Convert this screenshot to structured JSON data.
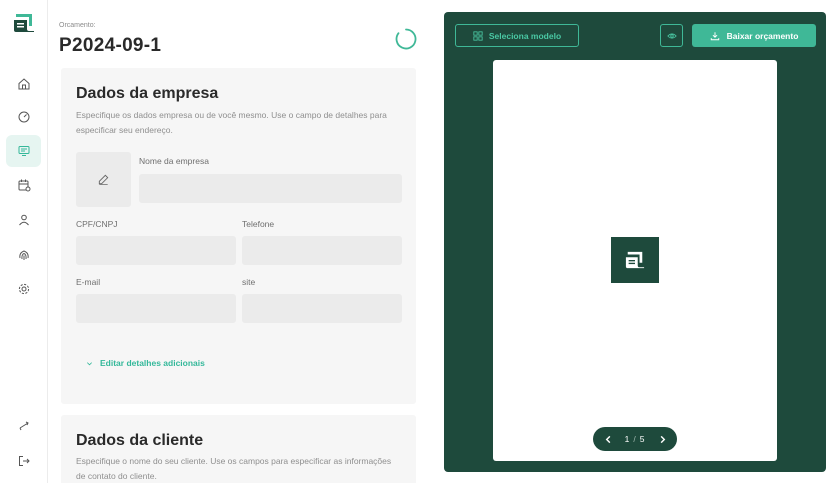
{
  "header": {
    "doc_label": "Orcamento:",
    "doc_number": "P2024-09-1"
  },
  "sidebar": {
    "items": [
      {
        "icon": "home-icon",
        "active": false
      },
      {
        "icon": "gauge-icon",
        "active": false
      },
      {
        "icon": "receipt-icon",
        "active": true
      },
      {
        "icon": "calendar-icon",
        "active": false
      },
      {
        "icon": "user-icon",
        "active": false
      },
      {
        "icon": "fingerprint-icon",
        "active": false
      },
      {
        "icon": "settings-icon",
        "active": false
      }
    ],
    "bottom": [
      {
        "icon": "switch-icon"
      },
      {
        "icon": "logout-icon"
      }
    ]
  },
  "company": {
    "title": "Dados da empresa",
    "description": "Especifique os dados empresa ou de você mesmo. Use o campo de detalhes para especificar seu endereço.",
    "fields": {
      "name_label": "Nome da empresa",
      "cpf_label": "CPF/CNPJ",
      "phone_label": "Telefone",
      "email_label": "E-mail",
      "site_label": "site"
    },
    "values": {
      "name": "",
      "cpf": "",
      "phone": "",
      "email": "",
      "site": ""
    },
    "edit_more": "Editar detalhes adicionais"
  },
  "client": {
    "title": "Dados da cliente",
    "description": "Especifique o nome do seu cliente. Use os campos para especificar as informações de contato do cliente."
  },
  "preview": {
    "select_model": "Seleciona modelo",
    "download": "Baixar orçamento",
    "page_current": "1",
    "page_total": "5"
  },
  "colors": {
    "brand": "#1e4a3c",
    "accent": "#3fb897",
    "active_bg": "#e6f5f1"
  }
}
